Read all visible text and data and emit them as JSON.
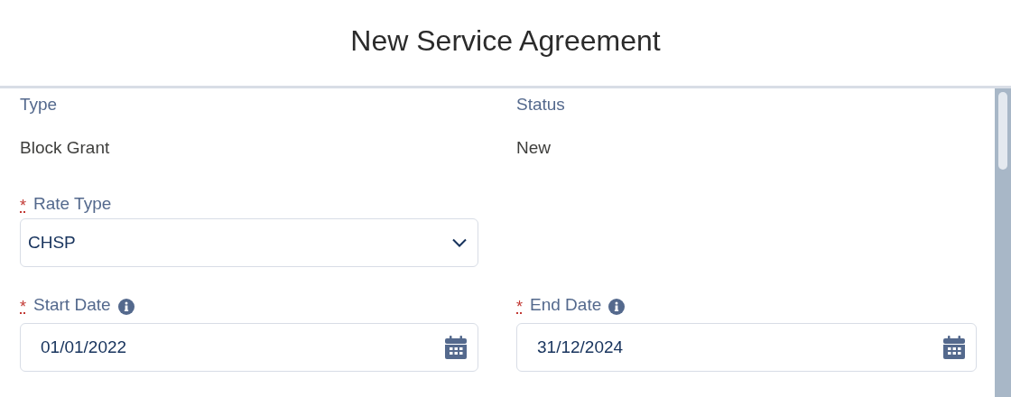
{
  "window": {
    "title": "New Service Agreement"
  },
  "required_marker": "*",
  "rows": [
    [
      {
        "kind": "readonly",
        "label": "Type",
        "value": "Block Grant"
      },
      {
        "kind": "readonly",
        "label": "Status",
        "value": "New"
      }
    ],
    [
      {
        "kind": "picklist",
        "label": "Rate Type",
        "required": true,
        "value": "CHSP"
      }
    ],
    [
      {
        "kind": "date",
        "label": "Start Date",
        "required": true,
        "info": true,
        "value": "01/01/2022"
      },
      {
        "kind": "date",
        "label": "End Date",
        "required": true,
        "info": true,
        "value": "31/12/2024"
      }
    ]
  ]
}
